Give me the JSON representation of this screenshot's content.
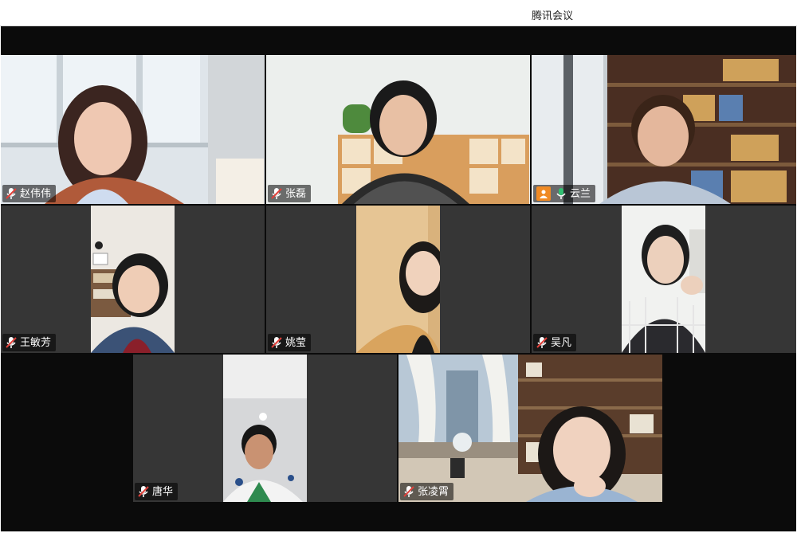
{
  "app": {
    "title": "腾讯会议"
  },
  "participants": [
    {
      "name": "赵伟伟",
      "mic": "muted"
    },
    {
      "name": "张磊",
      "mic": "muted"
    },
    {
      "name": "云兰",
      "mic": "speaking",
      "host_badge": "person-icon"
    },
    {
      "name": "王敏芳",
      "mic": "muted"
    },
    {
      "name": "姚莹",
      "mic": "muted"
    },
    {
      "name": "吴凡",
      "mic": "muted"
    },
    {
      "name": "唐华",
      "mic": "muted"
    },
    {
      "name": "张凌霄",
      "mic": "muted"
    }
  ],
  "colors": {
    "stage_bg": "#0b0b0b",
    "tile_bg": "#363636",
    "speaking_border": "#2fbf71",
    "mic_muted": "#e0403a",
    "mic_active": "#2fbf71",
    "host_badge": "#f08a24"
  }
}
